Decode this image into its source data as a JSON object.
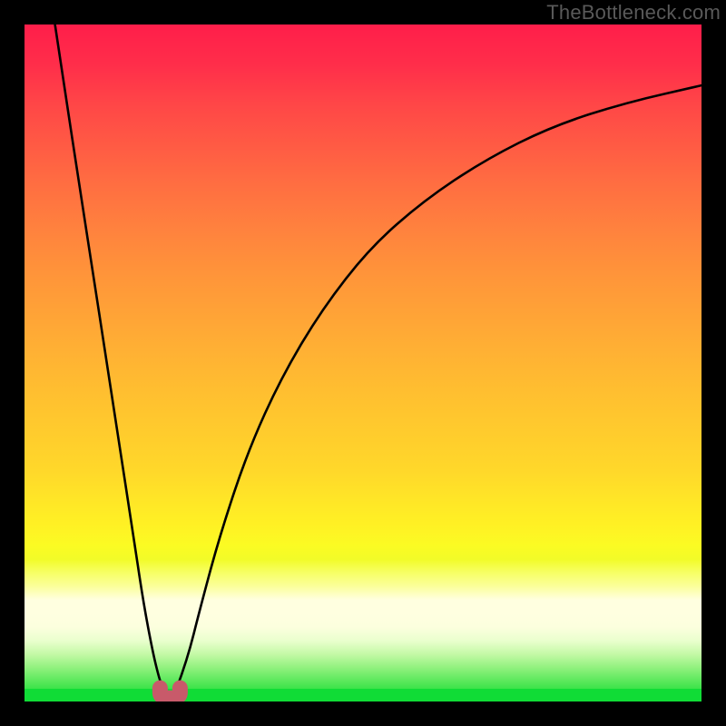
{
  "watermark": "TheBottleneck.com",
  "chart_data": {
    "type": "line",
    "title": "",
    "xlabel": "",
    "ylabel": "",
    "xlim": [
      0,
      1
    ],
    "ylim": [
      0,
      100
    ],
    "series": [
      {
        "name": "left-branch",
        "x": [
          0.045,
          0.06,
          0.08,
          0.1,
          0.12,
          0.14,
          0.16,
          0.175,
          0.19,
          0.2,
          0.205
        ],
        "values": [
          100,
          90,
          77,
          64,
          51,
          38,
          25,
          15,
          7,
          3,
          2
        ]
      },
      {
        "name": "right-branch",
        "x": [
          0.225,
          0.24,
          0.26,
          0.29,
          0.33,
          0.38,
          0.44,
          0.51,
          0.59,
          0.68,
          0.78,
          0.89,
          1.0
        ],
        "values": [
          2,
          6,
          14,
          25,
          37,
          48,
          58,
          67,
          74,
          80,
          85,
          88.5,
          91
        ]
      }
    ],
    "marker": {
      "name": "dip-marker",
      "x_center": 0.215,
      "values": [
        2,
        0.5,
        2
      ],
      "color": "#c85a6a"
    },
    "background_gradient": {
      "top_color": "#ff1e4a",
      "mid_color": "#ffe527",
      "bottom_color": "#10db35"
    },
    "frame_color": "#000000",
    "curve_color": "#000000",
    "grid": false,
    "legend": false
  }
}
